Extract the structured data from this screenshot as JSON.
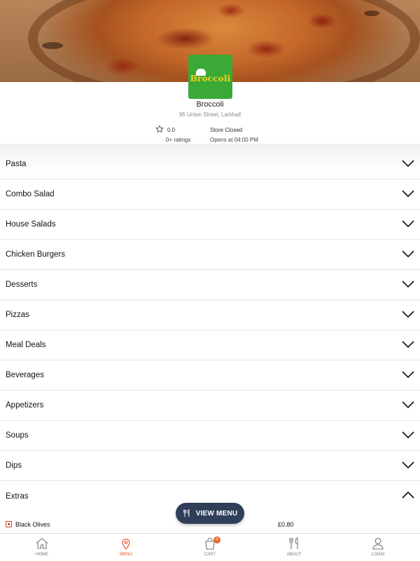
{
  "store": {
    "logo_text": "Broccoli",
    "name": "Broccoli",
    "address": "95 Union Street, Larkhall",
    "rating_value": "0.0",
    "rating_count": "0+ ratings",
    "status": "Store Closed",
    "opening": "Opens at 04:00 PM"
  },
  "categories": [
    {
      "label": "Pasta",
      "expanded": false
    },
    {
      "label": "Combo Salad",
      "expanded": false
    },
    {
      "label": "House Salads",
      "expanded": false
    },
    {
      "label": "Chicken Burgers",
      "expanded": false
    },
    {
      "label": "Desserts",
      "expanded": false
    },
    {
      "label": "Pizzas",
      "expanded": false
    },
    {
      "label": "Meal Deals",
      "expanded": false
    },
    {
      "label": "Beverages",
      "expanded": false
    },
    {
      "label": "Appetizers",
      "expanded": false
    },
    {
      "label": "Soups",
      "expanded": false
    },
    {
      "label": "Dips",
      "expanded": false
    },
    {
      "label": "Extras",
      "expanded": true
    }
  ],
  "extras_items": [
    {
      "name": "Black Olives",
      "price": "£0.80"
    }
  ],
  "view_menu_button": {
    "label": "VIEW MENU",
    "icon": "cutlery-icon"
  },
  "tabbar": {
    "tabs": [
      {
        "label": "HOME",
        "icon": "home-icon",
        "active": false
      },
      {
        "label": "MENU",
        "icon": "location-pin-icon",
        "active": true
      },
      {
        "label": "CART",
        "icon": "cart-icon",
        "active": false,
        "badge": "0"
      },
      {
        "label": "ABOUT",
        "icon": "cutlery-icon",
        "active": false
      },
      {
        "label": "LOGIN",
        "icon": "user-icon",
        "active": false
      }
    ]
  },
  "colors": {
    "accent": "#e24a1f",
    "button_bg": "#2f3f5a",
    "logo_bg": "#3aa935",
    "logo_text": "#f5d21e"
  }
}
